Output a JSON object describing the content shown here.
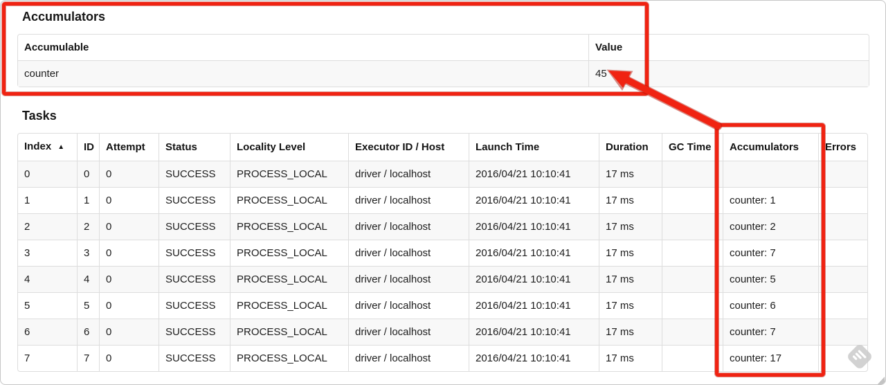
{
  "accumulators": {
    "title": "Accumulators",
    "columns": [
      "Accumulable",
      "Value"
    ],
    "rows": [
      [
        "counter",
        "45"
      ]
    ]
  },
  "tasks": {
    "title": "Tasks",
    "columns": [
      "Index",
      "ID",
      "Attempt",
      "Status",
      "Locality Level",
      "Executor ID / Host",
      "Launch Time",
      "Duration",
      "GC Time",
      "Accumulators",
      "Errors"
    ],
    "sort": {
      "column": "Index",
      "direction": "ascending",
      "icon": "▲"
    },
    "rows": [
      [
        "0",
        "0",
        "0",
        "SUCCESS",
        "PROCESS_LOCAL",
        "driver / localhost",
        "2016/04/21 10:10:41",
        "17 ms",
        "",
        "",
        ""
      ],
      [
        "1",
        "1",
        "0",
        "SUCCESS",
        "PROCESS_LOCAL",
        "driver / localhost",
        "2016/04/21 10:10:41",
        "17 ms",
        "",
        "counter: 1",
        ""
      ],
      [
        "2",
        "2",
        "0",
        "SUCCESS",
        "PROCESS_LOCAL",
        "driver / localhost",
        "2016/04/21 10:10:41",
        "17 ms",
        "",
        "counter: 2",
        ""
      ],
      [
        "3",
        "3",
        "0",
        "SUCCESS",
        "PROCESS_LOCAL",
        "driver / localhost",
        "2016/04/21 10:10:41",
        "17 ms",
        "",
        "counter: 7",
        ""
      ],
      [
        "4",
        "4",
        "0",
        "SUCCESS",
        "PROCESS_LOCAL",
        "driver / localhost",
        "2016/04/21 10:10:41",
        "17 ms",
        "",
        "counter: 5",
        ""
      ],
      [
        "5",
        "5",
        "0",
        "SUCCESS",
        "PROCESS_LOCAL",
        "driver / localhost",
        "2016/04/21 10:10:41",
        "17 ms",
        "",
        "counter: 6",
        ""
      ],
      [
        "6",
        "6",
        "0",
        "SUCCESS",
        "PROCESS_LOCAL",
        "driver / localhost",
        "2016/04/21 10:10:41",
        "17 ms",
        "",
        "counter: 7",
        ""
      ],
      [
        "7",
        "7",
        "0",
        "SUCCESS",
        "PROCESS_LOCAL",
        "driver / localhost",
        "2016/04/21 10:10:41",
        "17 ms",
        "",
        "counter: 17",
        ""
      ]
    ]
  },
  "annotations": {
    "red": "#f02312",
    "red_dark": "#b5170a",
    "highlighted_value": "45",
    "highlighted_column": "Accumulators"
  },
  "watermark": {
    "name": "skitch-stamp",
    "color": "#cbcbcb"
  }
}
